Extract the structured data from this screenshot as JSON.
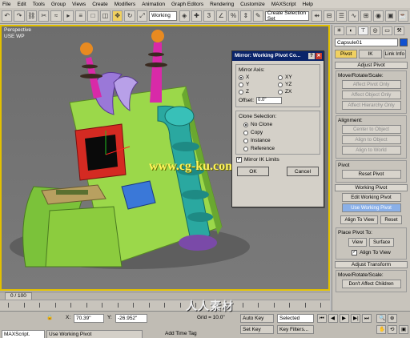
{
  "menu": [
    "File",
    "Edit",
    "Tools",
    "Group",
    "Views",
    "Create",
    "Modifiers",
    "Animation",
    "Graph Editors",
    "Rendering",
    "Customize",
    "MAXScript",
    "Help"
  ],
  "toolbar": {
    "ref_coord": "Working",
    "selection_set": "Create Selection Set"
  },
  "viewport": {
    "label": "Perspective",
    "sub_label": "USE WP"
  },
  "watermark": "www.cg-ku.com",
  "dialog": {
    "title": "Mirror: Working Pivot Co...",
    "help": "?",
    "mirror_axis_title": "Mirror Axis:",
    "axes": [
      "X",
      "XY",
      "Y",
      "YZ",
      "Z",
      "ZX"
    ],
    "axis_selected": "X",
    "offset_label": "Offset:",
    "offset_value": "0.0\"",
    "clone_title": "Clone Selection:",
    "clone_options": [
      "No Clone",
      "Copy",
      "Instance",
      "Reference"
    ],
    "clone_selected": "No Clone",
    "mirror_ik_label": "Mirror IK Limits",
    "ok": "OK",
    "cancel": "Cancel"
  },
  "panel": {
    "object_name": "Capsule01",
    "swatch_color": "#1050d0",
    "tabs": [
      "Pivot",
      "IK",
      "Link Info"
    ],
    "active_tab": "Pivot",
    "adjust_pivot": "Adjust Pivot",
    "move_rotate_scale": "Move/Rotate/Scale:",
    "affect_buttons": [
      "Affect Pivot Only",
      "Affect Object Only",
      "Affect Hierarchy Only"
    ],
    "alignment": "Alignment:",
    "align_buttons": [
      "Center to Object",
      "Align to Object",
      "Align to World"
    ],
    "pivot_group": "Pivot",
    "reset_pivot": "Reset Pivot",
    "working_pivot": "Working Pivot",
    "edit_working_pivot": "Edit Working Pivot",
    "use_working_pivot": "Use Working Pivot",
    "align_to_view": "Align To View",
    "reset": "Reset",
    "place_pivot_to": "Place Pivot To:",
    "view": "View",
    "surface": "Surface",
    "align_to_view_check": "Align To View",
    "adjust_transform": "Adjust Transform",
    "move_rotate_scale2": "Move/Rotate/Scale:",
    "dont_affect_children": "Don't Affect Children"
  },
  "timeline": {
    "frame": "0 / 100"
  },
  "status": {
    "maxscript": "MAXScript.",
    "prompt": "Use Working Pivot",
    "x_label": "X:",
    "x_value": "70.39\"",
    "y_label": "Y:",
    "y_value": "-26.952\"",
    "grid_label": "Grid = 10.0\"",
    "auto_key": "Auto Key",
    "selected": "Selected",
    "set_key": "Set Key",
    "key_filters": "Key Filters...",
    "add_time_tag": "Add Time Tag"
  },
  "logo_text": "人人素材"
}
